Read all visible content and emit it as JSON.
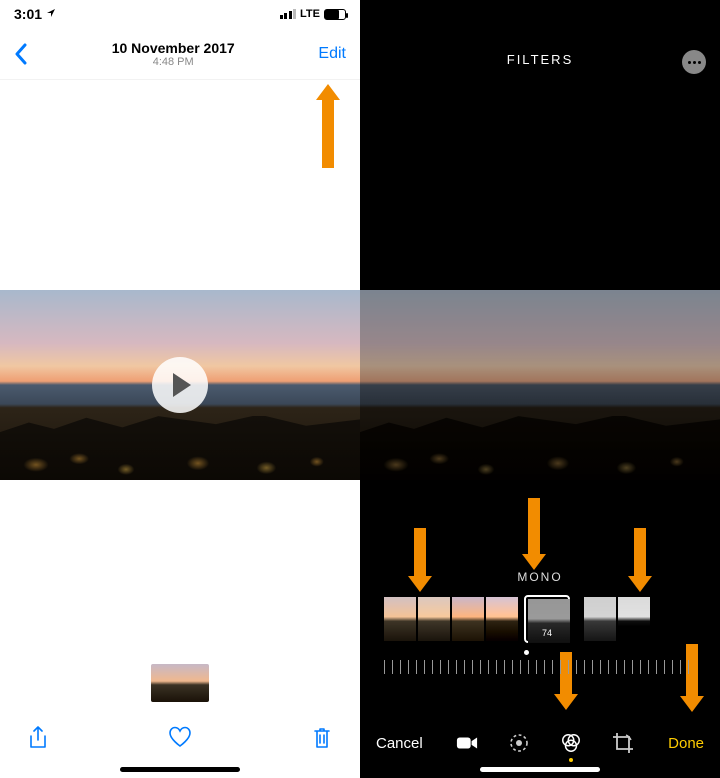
{
  "left": {
    "status": {
      "time": "3:01",
      "carrier": "LTE"
    },
    "nav": {
      "date": "10 November 2017",
      "time": "4:48 PM",
      "edit": "Edit"
    }
  },
  "right": {
    "header": {
      "title": "FILTERS"
    },
    "filter": {
      "name": "MONO",
      "selected_intensity": "74"
    },
    "toolbar": {
      "cancel": "Cancel",
      "done": "Done"
    }
  }
}
